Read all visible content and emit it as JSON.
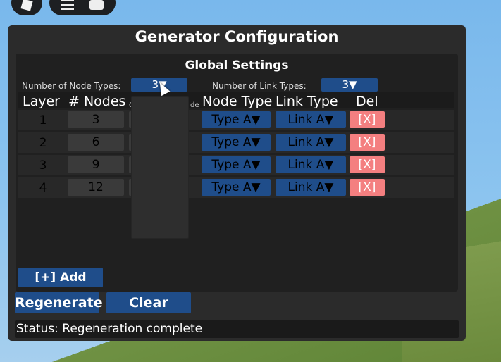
{
  "topbar": {
    "logo_icon": "roblox-logo-icon",
    "menu_icon": "hamburger-icon",
    "chat_icon": "chat-icon"
  },
  "panel": {
    "title": "Generator Configuration",
    "global_settings": {
      "title": "Global Settings",
      "node_types_label": "Number of Node Types:",
      "node_types_value": "3▼",
      "link_types_label": "Number of Link Types:",
      "link_types_value": "3▼"
    },
    "table": {
      "headers": {
        "layer": "Layer",
        "nodes": "# Nodes",
        "hidden_col": "C",
        "hidden_col2": "de",
        "node_type": "Node Type",
        "link_type": "Link Type",
        "del": "Del"
      },
      "rows": [
        {
          "layer": "1",
          "nodes": "3",
          "node_type": "Type A▼",
          "link_type": "Link A▼",
          "del": "[X]"
        },
        {
          "layer": "2",
          "nodes": "6",
          "node_type": "Type A▼",
          "link_type": "Link A▼",
          "del": "[X]"
        },
        {
          "layer": "3",
          "nodes": "9",
          "node_type": "Type A▼",
          "link_type": "Link A▼",
          "del": "[X]"
        },
        {
          "layer": "4",
          "nodes": "12",
          "node_type": "Type A▼",
          "link_type": "Link A▼",
          "del": "[X]"
        }
      ]
    },
    "buttons": {
      "add_layer": "[+] Add Layer",
      "regenerate": "Regenerate",
      "clear": "Clear"
    },
    "status": "Status: Regeneration complete"
  },
  "colors": {
    "panel_bg": "#2b2b2b",
    "button_blue": "#1f4d8a",
    "delete_red": "#f47f80"
  }
}
